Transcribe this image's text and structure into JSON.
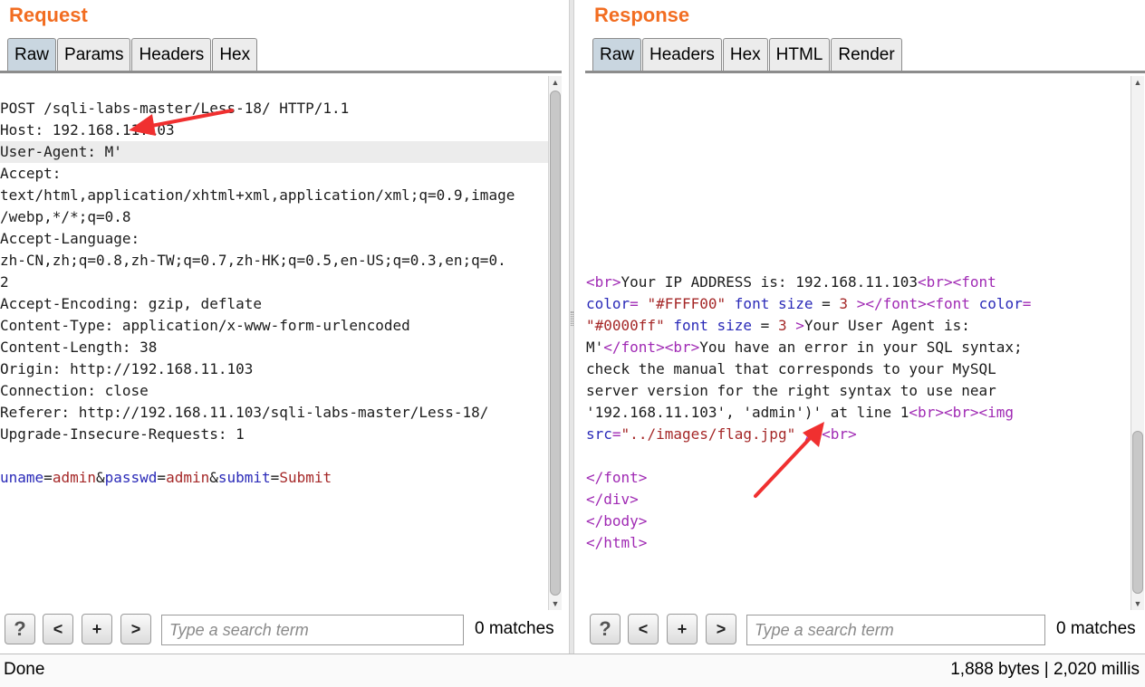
{
  "request": {
    "title": "Request",
    "tabs": [
      "Raw",
      "Params",
      "Headers",
      "Hex"
    ],
    "active_tab": "Raw",
    "lines": [
      "POST /sqli-labs-master/Less-18/ HTTP/1.1",
      "Host: 192.168.11.103",
      "User-Agent: M'",
      "Accept:",
      "text/html,application/xhtml+xml,application/xml;q=0.9,image",
      "/webp,*/*;q=0.8",
      "Accept-Language:",
      "zh-CN,zh;q=0.8,zh-TW;q=0.7,zh-HK;q=0.5,en-US;q=0.3,en;q=0.",
      "2",
      "Accept-Encoding: gzip, deflate",
      "Content-Type: application/x-www-form-urlencoded",
      "Content-Length: 38",
      "Origin: http://192.168.11.103",
      "Connection: close",
      "Referer: http://192.168.11.103/sqli-labs-master/Less-18/",
      "Upgrade-Insecure-Requests: 1",
      ""
    ],
    "body_params": [
      {
        "key": "uname",
        "value": "admin"
      },
      {
        "key": "passwd",
        "value": "admin"
      },
      {
        "key": "submit",
        "value": "Submit"
      }
    ],
    "search": {
      "help": "?",
      "prev": "<",
      "add": "+",
      "next": ">",
      "placeholder": "Type a search term",
      "matches": "0 matches"
    }
  },
  "response": {
    "title": "Response",
    "tabs": [
      "Raw",
      "Headers",
      "Hex",
      "HTML",
      "Render"
    ],
    "active_tab": "Raw",
    "search": {
      "help": "?",
      "prev": "<",
      "add": "+",
      "next": ">",
      "placeholder": "Type a search term",
      "matches": "0 matches"
    }
  },
  "status": {
    "left": "Done",
    "right": "1,888 bytes | 2,020 millis"
  },
  "colors": {
    "title": "#f26d21",
    "annotation_arrow": "#f03030"
  }
}
